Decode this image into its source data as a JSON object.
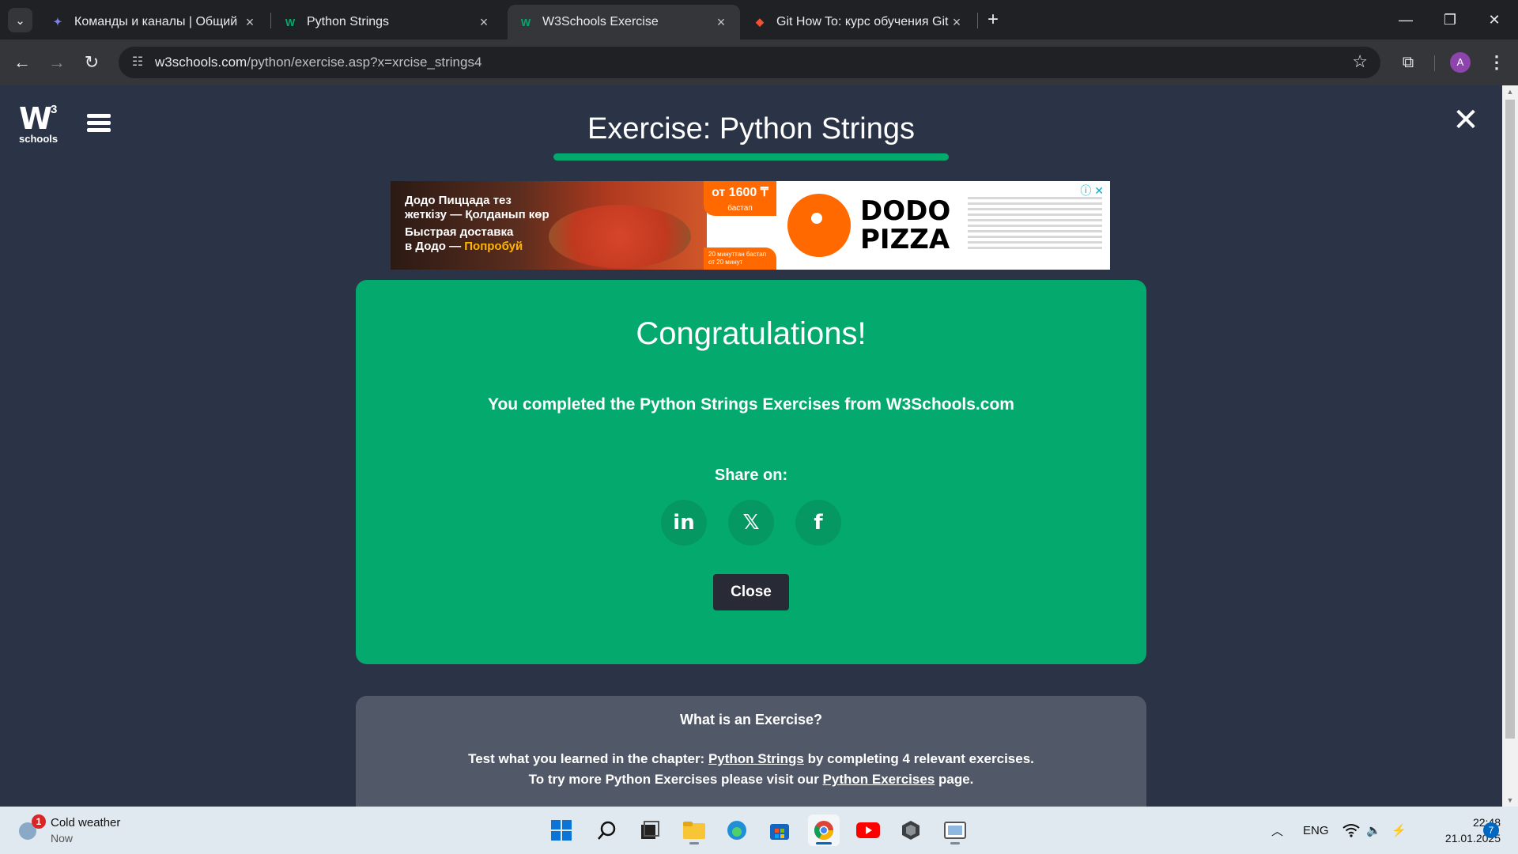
{
  "browser": {
    "tabs": [
      {
        "title": "Команды и каналы | Общий | M",
        "favicon": "teams-icon",
        "active": false
      },
      {
        "title": "Python Strings",
        "favicon": "w3schools-icon",
        "active": false
      },
      {
        "title": "W3Schools Exercise",
        "favicon": "w3schools-icon",
        "active": true
      },
      {
        "title": "Git How To: курс обучения Git",
        "favicon": "git-icon",
        "active": false
      }
    ],
    "url_host": "w3schools.com",
    "url_path": "/python/exercise.asp?x=xrcise_strings4",
    "profile_initial": "A"
  },
  "page": {
    "logo_mark": "W",
    "logo_superscript": "3",
    "logo_text": "schools",
    "title": "Exercise: Python Strings",
    "accent_color": "#04aa6d"
  },
  "ad": {
    "line1": "Додо Пиццада тез",
    "line2": "жеткізу — Қолданып көр",
    "line3": "Быстрая доставка",
    "line4_a": "в Додо — ",
    "line4_b": "Попробуй",
    "price": "от 1600 ₸",
    "price_sub": "бастап",
    "promo": "20 минуттан бастап от 20 минут",
    "brand_line1": "DODO",
    "brand_line2": "PIZZA"
  },
  "congrats": {
    "heading": "Congratulations!",
    "message": "You completed the Python Strings Exercises from W3Schools.com",
    "share_label": "Share on:",
    "share_linkedin": "in",
    "share_x": "𝕏",
    "share_facebook": "f",
    "close_label": "Close"
  },
  "info": {
    "question": "What is an Exercise?",
    "line1_before": "Test what you learned in the chapter: ",
    "line1_link": "Python Strings",
    "line1_after": " by completing 4 relevant exercises.",
    "line2_before": "To try more Python Exercises please visit our ",
    "line2_link": "Python Exercises",
    "line2_after": " page."
  },
  "taskbar": {
    "weather_title": "Cold weather",
    "weather_sub": "Now",
    "weather_badge": "1",
    "language": "ENG",
    "time": "22:48",
    "date": "21.01.2025",
    "notification_count": "7"
  }
}
